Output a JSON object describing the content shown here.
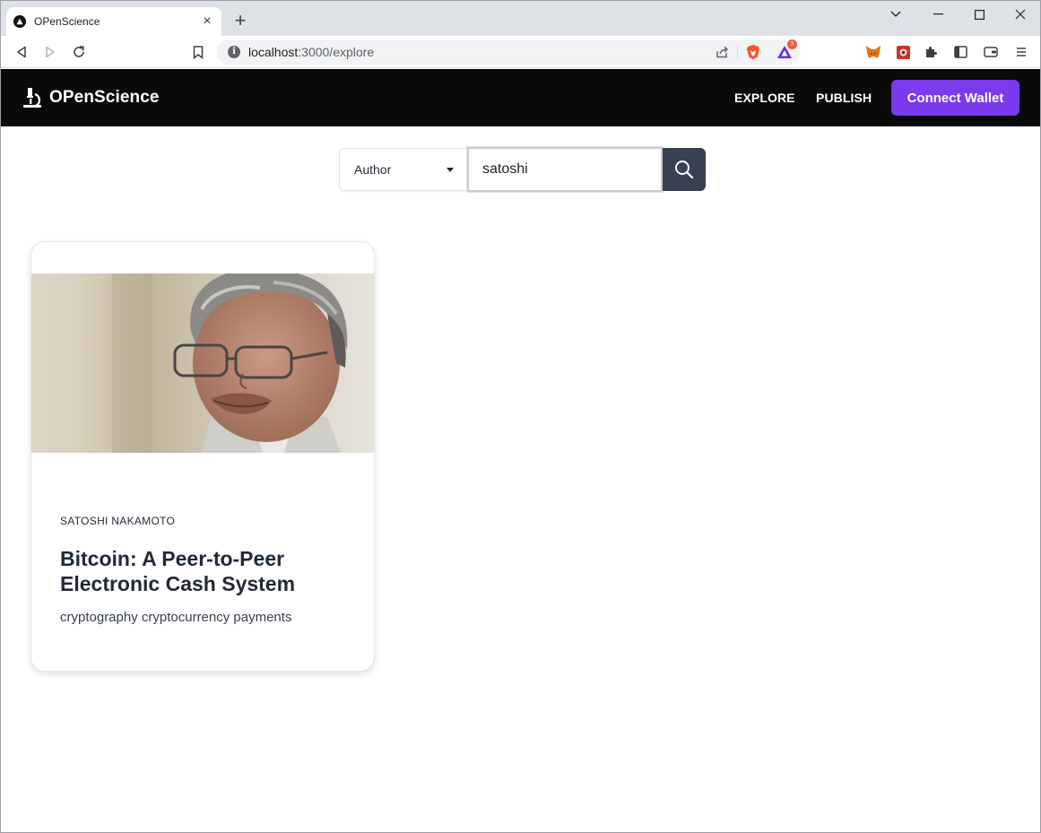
{
  "browser": {
    "tab_title": "OPenScience",
    "tab_close": "×",
    "new_tab": "+",
    "url_host": "localhost",
    "url_path": ":3000/explore",
    "rewards_badge": "3"
  },
  "navbar": {
    "brand": "OPenScience",
    "explore": "EXPLORE",
    "publish": "PUBLISH",
    "connect": "Connect Wallet"
  },
  "search": {
    "filter": "Author",
    "query": "satoshi"
  },
  "results": [
    {
      "author": "SATOSHI NAKAMOTO",
      "title": "Bitcoin: A Peer-to-Peer Electronic Cash System",
      "tags": "cryptography cryptocurrency payments"
    }
  ],
  "colors": {
    "accent": "#7c3aed",
    "navbar": "#0a0a0a",
    "search_button": "#374151"
  }
}
